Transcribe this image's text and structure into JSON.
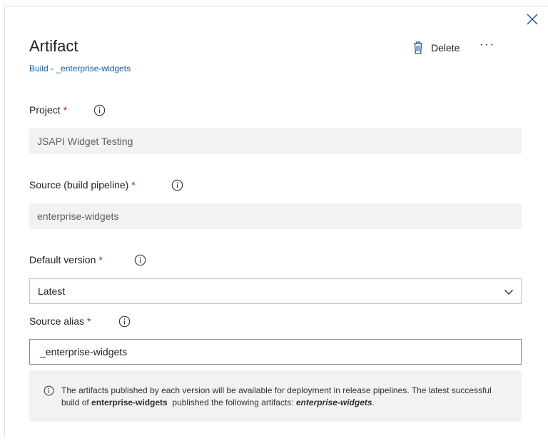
{
  "header": {
    "title": "Artifact",
    "breadcrumb": "Build - _enterprise-widgets",
    "delete_label": "Delete",
    "more_label": "···"
  },
  "form": {
    "required_mark": "*",
    "project": {
      "label": "Project",
      "value": "JSAPI Widget Testing"
    },
    "source": {
      "label": "Source (build pipeline)",
      "value": "enterprise-widgets"
    },
    "default_version": {
      "label": "Default version",
      "value": "Latest"
    },
    "source_alias": {
      "label": "Source alias",
      "value": "_enterprise-widgets"
    }
  },
  "note": {
    "part1": "The artifacts published by each version will be available for deployment in release pipelines. The latest successful build of ",
    "bold1": "enterprise-widgets",
    "part2": "  published the following artifacts: ",
    "bold2": "enterprise-widgets",
    "part3": "."
  },
  "icons": [
    "close-icon",
    "trash-icon",
    "more-icon",
    "info-icon",
    "chevron-down-icon"
  ],
  "colors": {
    "link": "#0e5fa8",
    "required": "#a4262c",
    "field_bg": "#f3f2f1"
  }
}
